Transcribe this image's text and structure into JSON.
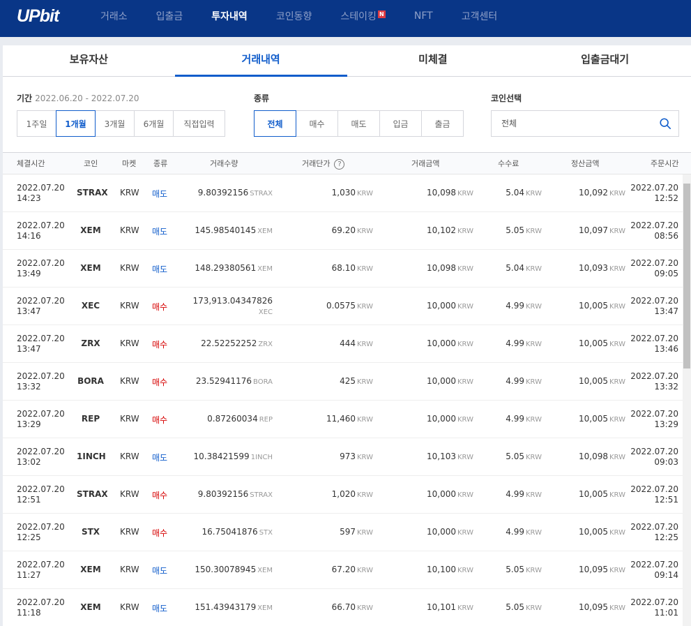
{
  "brand": {
    "logo": "UPbit"
  },
  "nav": [
    "거래소",
    "입출금",
    "투자내역",
    "코인동향",
    "스테이킹",
    "NFT",
    "고객센터"
  ],
  "nav_active": "투자내역",
  "nav_badge": "N",
  "tabs": [
    "보유자산",
    "거래내역",
    "미체결",
    "입출금대기"
  ],
  "filters": {
    "period_label": "기간",
    "period_range": "2022.06.20 - 2022.07.20",
    "period_buttons": [
      "1주일",
      "1개월",
      "3개월",
      "6개월",
      "직접입력"
    ],
    "type_label": "종류",
    "type_buttons": [
      "전체",
      "매수",
      "매도",
      "입금",
      "출금"
    ],
    "coin_label": "코인선택",
    "coin_value": "전체"
  },
  "table": {
    "headers": [
      "체결시간",
      "코인",
      "마켓",
      "종류",
      "거래수량",
      "거래단가",
      "거래금액",
      "수수료",
      "정산금액",
      "주문시간"
    ],
    "help": "?",
    "rows": [
      {
        "date": "2022.07.20",
        "time": "14:23",
        "coin": "STRAX",
        "market": "KRW",
        "type": "매도",
        "side": "sell",
        "qty": "9.80392156",
        "qty_unit": "STRAX",
        "price": "1,030",
        "amount": "10,098",
        "fee": "5.04",
        "settle": "10,092",
        "odate": "2022.07.20",
        "otime": "12:52"
      },
      {
        "date": "2022.07.20",
        "time": "14:16",
        "coin": "XEM",
        "market": "KRW",
        "type": "매도",
        "side": "sell",
        "qty": "145.98540145",
        "qty_unit": "XEM",
        "price": "69.20",
        "amount": "10,102",
        "fee": "5.05",
        "settle": "10,097",
        "odate": "2022.07.20",
        "otime": "08:56"
      },
      {
        "date": "2022.07.20",
        "time": "13:49",
        "coin": "XEM",
        "market": "KRW",
        "type": "매도",
        "side": "sell",
        "qty": "148.29380561",
        "qty_unit": "XEM",
        "price": "68.10",
        "amount": "10,098",
        "fee": "5.04",
        "settle": "10,093",
        "odate": "2022.07.20",
        "otime": "09:05"
      },
      {
        "date": "2022.07.20",
        "time": "13:47",
        "coin": "XEC",
        "market": "KRW",
        "type": "매수",
        "side": "buy",
        "qty": "173,913.04347826",
        "qty_unit": "XEC",
        "wrap": true,
        "price": "0.0575",
        "amount": "10,000",
        "fee": "4.99",
        "settle": "10,005",
        "odate": "2022.07.20",
        "otime": "13:47"
      },
      {
        "date": "2022.07.20",
        "time": "13:47",
        "coin": "ZRX",
        "market": "KRW",
        "type": "매수",
        "side": "buy",
        "qty": "22.52252252",
        "qty_unit": "ZRX",
        "price": "444",
        "amount": "10,000",
        "fee": "4.99",
        "settle": "10,005",
        "odate": "2022.07.20",
        "otime": "13:46"
      },
      {
        "date": "2022.07.20",
        "time": "13:32",
        "coin": "BORA",
        "market": "KRW",
        "type": "매수",
        "side": "buy",
        "qty": "23.52941176",
        "qty_unit": "BORA",
        "price": "425",
        "amount": "10,000",
        "fee": "4.99",
        "settle": "10,005",
        "odate": "2022.07.20",
        "otime": "13:32"
      },
      {
        "date": "2022.07.20",
        "time": "13:29",
        "coin": "REP",
        "market": "KRW",
        "type": "매수",
        "side": "buy",
        "qty": "0.87260034",
        "qty_unit": "REP",
        "price": "11,460",
        "amount": "10,000",
        "fee": "4.99",
        "settle": "10,005",
        "odate": "2022.07.20",
        "otime": "13:29"
      },
      {
        "date": "2022.07.20",
        "time": "13:02",
        "coin": "1INCH",
        "market": "KRW",
        "type": "매도",
        "side": "sell",
        "qty": "10.38421599",
        "qty_unit": "1INCH",
        "price": "973",
        "amount": "10,103",
        "fee": "5.05",
        "settle": "10,098",
        "odate": "2022.07.20",
        "otime": "09:03"
      },
      {
        "date": "2022.07.20",
        "time": "12:51",
        "coin": "STRAX",
        "market": "KRW",
        "type": "매수",
        "side": "buy",
        "qty": "9.80392156",
        "qty_unit": "STRAX",
        "price": "1,020",
        "amount": "10,000",
        "fee": "4.99",
        "settle": "10,005",
        "odate": "2022.07.20",
        "otime": "12:51"
      },
      {
        "date": "2022.07.20",
        "time": "12:25",
        "coin": "STX",
        "market": "KRW",
        "type": "매수",
        "side": "buy",
        "qty": "16.75041876",
        "qty_unit": "STX",
        "price": "597",
        "amount": "10,000",
        "fee": "4.99",
        "settle": "10,005",
        "odate": "2022.07.20",
        "otime": "12:25"
      },
      {
        "date": "2022.07.20",
        "time": "11:27",
        "coin": "XEM",
        "market": "KRW",
        "type": "매도",
        "side": "sell",
        "qty": "150.30078945",
        "qty_unit": "XEM",
        "price": "67.20",
        "amount": "10,100",
        "fee": "5.05",
        "settle": "10,095",
        "odate": "2022.07.20",
        "otime": "09:14"
      },
      {
        "date": "2022.07.20",
        "time": "11:18",
        "coin": "XEM",
        "market": "KRW",
        "type": "매도",
        "side": "sell",
        "qty": "151.43943179",
        "qty_unit": "XEM",
        "price": "66.70",
        "amount": "10,101",
        "fee": "5.05",
        "settle": "10,095",
        "odate": "2022.07.20",
        "otime": "11:01"
      }
    ]
  },
  "units": {
    "krw": "KRW"
  },
  "colors": {
    "brand": "#093687",
    "accent": "#115dcb",
    "buy": "#d60000",
    "sell": "#115dcb"
  }
}
